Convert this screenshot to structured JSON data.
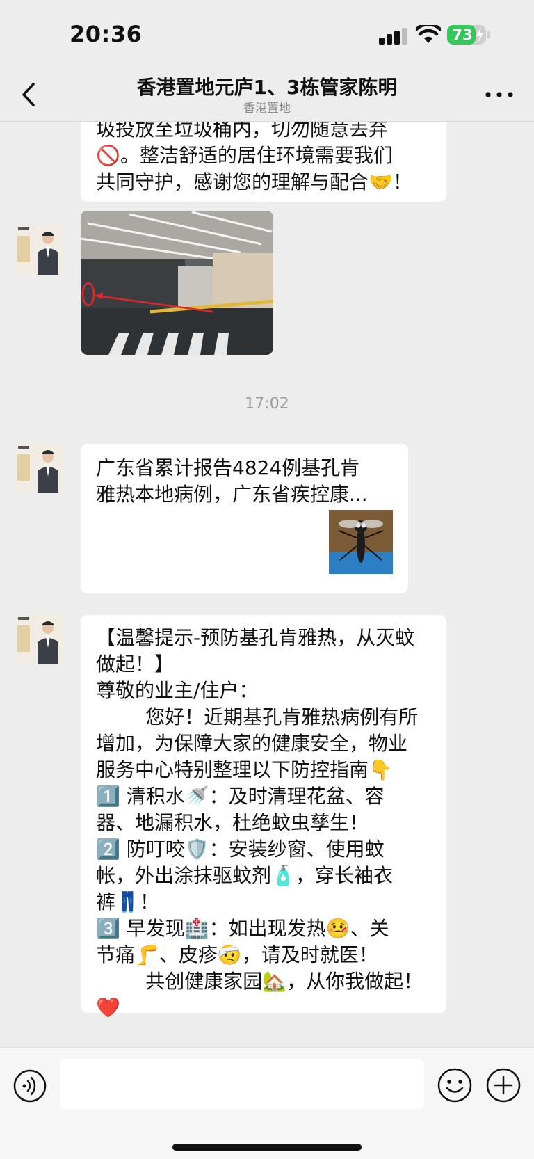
{
  "status_bar": {
    "time": "20:36",
    "battery_level": 73,
    "battery_text": "73"
  },
  "header": {
    "back_icon": "chevron-left-icon",
    "title": "香港置地元庐1、3栋管家陈明",
    "subtitle": "香港置地",
    "more_icon": "ellipsis-icon"
  },
  "messages": [
    {
      "type": "text",
      "text": "圾投放至垃圾桶内，切勿随意丢弃\n🚫。整洁舒适的居住环境需要我们\n共同守护，感谢您的理解与配合🤝！"
    },
    {
      "type": "image",
      "icon": "parking-garage-photo"
    },
    {
      "type": "timestamp",
      "text": "17:02"
    },
    {
      "type": "link",
      "text": "广东省累计报告4824例基孔肯\n雅热本地病例，广东省疾控康...",
      "icon": "mosquito-thumbnail"
    },
    {
      "type": "text",
      "text": "【温馨提示-预防基孔肯雅热，从灭蚊\n做起！】\n尊敬的业主/住户：\n        您好！近期基孔肯雅热病例有所\n增加，为保障大家的健康安全，物业\n服务中心特别整理以下防控指南👇\n1️⃣ 清积水🚿：及时清理花盆、容\n器、地漏积水，杜绝蚊虫孳生！\n2️⃣ 防叮咬🛡️：安装纱窗、使用蚊\n帐，外出涂抹驱蚊剂🧴，穿长袖衣\n裤👖！\n3️⃣ 早发现🏥：如出现发热🤒、关\n节痛🦵、皮疹🤕，请及时就医！\n        共创健康家园🏡，从你我做起！\n❤️"
    }
  ],
  "input_bar": {
    "placeholder": "",
    "voice_icon": "voice-icon",
    "emoji_icon": "emoji-icon",
    "plus_icon": "plus-icon"
  },
  "colors": {
    "battery": "#34c759",
    "background": "#ededed",
    "bubble": "#ffffff"
  }
}
